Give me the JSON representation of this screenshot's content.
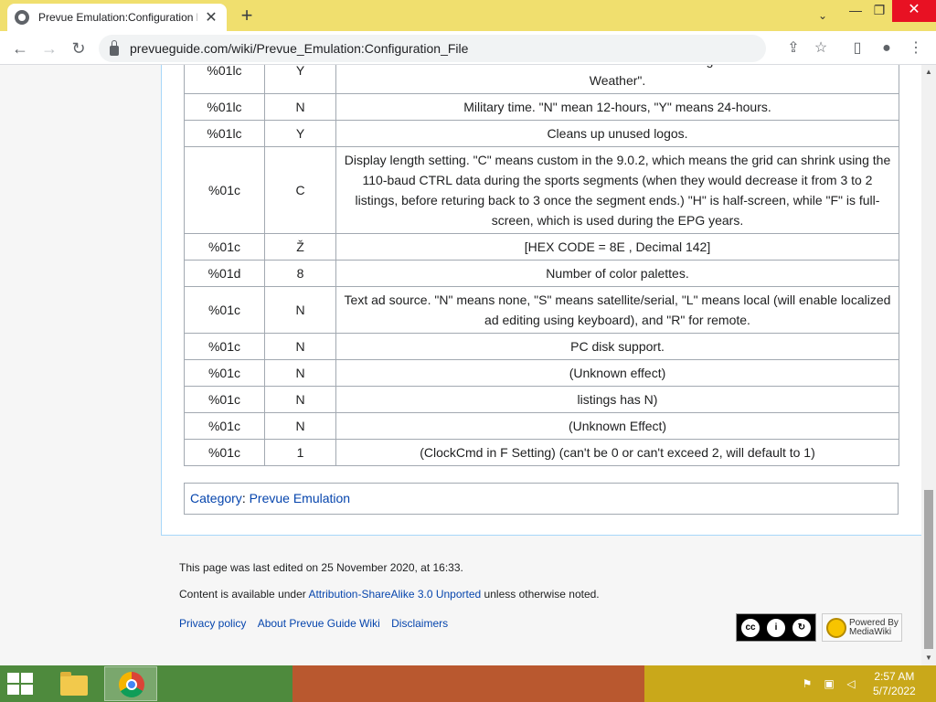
{
  "browser": {
    "tab_title": "Prevue Emulation:Configuration F",
    "url": "prevueguide.com/wiki/Prevue_Emulation:Configuration_File",
    "close_tab": "✕",
    "new_tab": "+"
  },
  "table": {
    "rows": [
      {
        "code": "%01lc",
        "value": "Y",
        "description": "Prevue rebranded and introduced weather forecasts as a segment on \"Prevue News and Weather\"."
      },
      {
        "code": "%01lc",
        "value": "N",
        "description": "Military time. \"N\" mean 12-hours, \"Y\" means 24-hours."
      },
      {
        "code": "%01lc",
        "value": "Y",
        "description": "Cleans up unused logos."
      },
      {
        "code": "%01c",
        "value": "C",
        "description": "Display length setting. \"C\" means custom in the 9.0.2, which means the grid can shrink using the 110-baud CTRL data during the sports segments (when they would decrease it from 3 to 2 listings, before returing back to 3 once the segment ends.) \"H\" is half-screen, while \"F\" is full-screen, which is used during the EPG years."
      },
      {
        "code": "%01c",
        "value": "Ž",
        "description": "[HEX CODE = 8E , Decimal 142]"
      },
      {
        "code": "%01d",
        "value": "8",
        "description": "Number of color palettes."
      },
      {
        "code": "%01c",
        "value": "N",
        "description": "Text ad source. \"N\" means none, \"S\" means satellite/serial, \"L\" means local (will enable localized ad editing using keyboard), and \"R\" for remote."
      },
      {
        "code": "%01c",
        "value": "N",
        "description": "PC disk support."
      },
      {
        "code": "%01c",
        "value": "N",
        "description": "(Unknown effect)"
      },
      {
        "code": "%01c",
        "value": "N",
        "description": "listings has N)"
      },
      {
        "code": "%01c",
        "value": "N",
        "description": "(Unknown Effect)"
      },
      {
        "code": "%01c",
        "value": "1",
        "description": "(ClockCmd in F Setting) (can't be 0 or can't exceed 2, will default to 1)"
      }
    ]
  },
  "category": {
    "label": "Category",
    "link": "Prevue Emulation"
  },
  "footer": {
    "last_edited": "This page was last edited on 25 November 2020, at 16:33.",
    "license_prefix": "Content is available under ",
    "license_link": "Attribution-ShareAlike 3.0 Unported",
    "license_suffix": " unless otherwise noted.",
    "links": [
      "Privacy policy",
      "About Prevue Guide Wiki",
      "Disclaimers"
    ],
    "cc_badge": "BY SA",
    "mw_badge_line1": "Powered By",
    "mw_badge_line2": "MediaWiki"
  },
  "taskbar": {
    "time": "2:57 AM",
    "date": "5/7/2022"
  },
  "colors": {
    "tab_strip": "#f0df6e",
    "link": "#0645ad",
    "taskbar_green": "#4e8a3d",
    "taskbar_orange": "#b9582f",
    "taskbar_yellow": "#c9a81a"
  }
}
